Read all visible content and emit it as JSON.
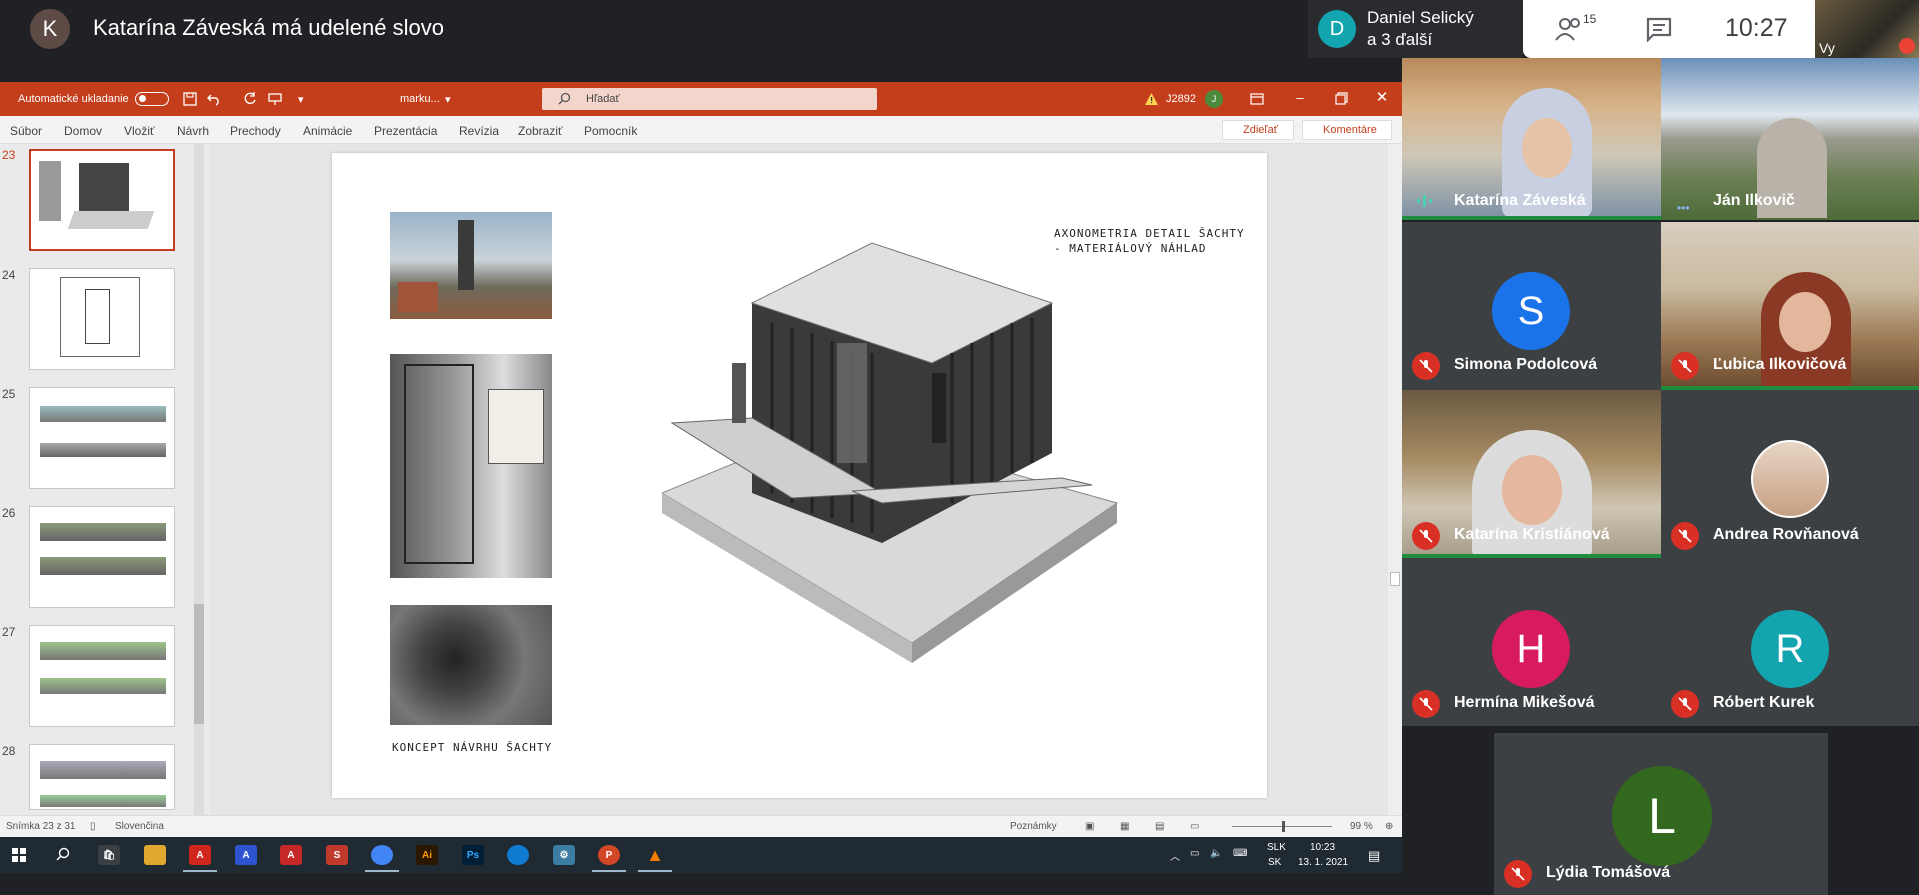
{
  "meet": {
    "presenter_initial": "K",
    "presenter_text": "Katarína Záveská má udelené slovo",
    "pinned_initial": "D",
    "pinned_name": "Daniel Selický",
    "pinned_more": "a 3 ďalší",
    "people_count": "15",
    "time": "10:27",
    "self_label": "Vy"
  },
  "ppt": {
    "autosave_label": "Automatické ukladanie",
    "file_name": "marku...",
    "search_placeholder": "Hľadať",
    "user_code": "J2892",
    "user_initial": "J",
    "menu": [
      "Súbor",
      "Domov",
      "Vložiť",
      "Návrh",
      "Prechody",
      "Animácie",
      "Prezentácia",
      "Revízia",
      "Zobraziť",
      "Pomocník"
    ],
    "share_label": "Zdieľať",
    "comments_label": "Komentáre",
    "slide_numbers": [
      "23",
      "24",
      "25",
      "26",
      "27",
      "28"
    ],
    "slide_caption_right_1": "AXONOMETRIA DETAIL ŠACHTY",
    "slide_caption_right_2": "- MATERIÁLOVÝ NÁHLAD",
    "slide_caption_bottom": "KONCEPT NÁVRHU ŠACHTY",
    "status_slide": "Snímka 23 z 31",
    "status_lang": "Slovenčina",
    "status_notes": "Poznámky",
    "status_zoom": "99 %"
  },
  "taskbar": {
    "lang1": "SLK",
    "lang2": "SK",
    "time": "10:23",
    "date": "13. 1. 2021"
  },
  "participants": [
    {
      "name": "Katarína Záveská",
      "initial": "",
      "color": ""
    },
    {
      "name": "Ján Ilkovič",
      "initial": "",
      "color": ""
    },
    {
      "name": "Simona Podolcová",
      "initial": "S",
      "color": "#1a73e8"
    },
    {
      "name": "Ľubica Ilkovičová",
      "initial": "",
      "color": ""
    },
    {
      "name": "Katarína Kristiánová",
      "initial": "",
      "color": ""
    },
    {
      "name": "Andrea Rovňanová",
      "initial": "",
      "color": ""
    },
    {
      "name": "Hermína Mikešová",
      "initial": "H",
      "color": "#d81b60"
    },
    {
      "name": "Róbert Kurek",
      "initial": "R",
      "color": "#12a4af"
    },
    {
      "name": "Lýdia Tomášová",
      "initial": "L",
      "color": "#33691e"
    }
  ]
}
